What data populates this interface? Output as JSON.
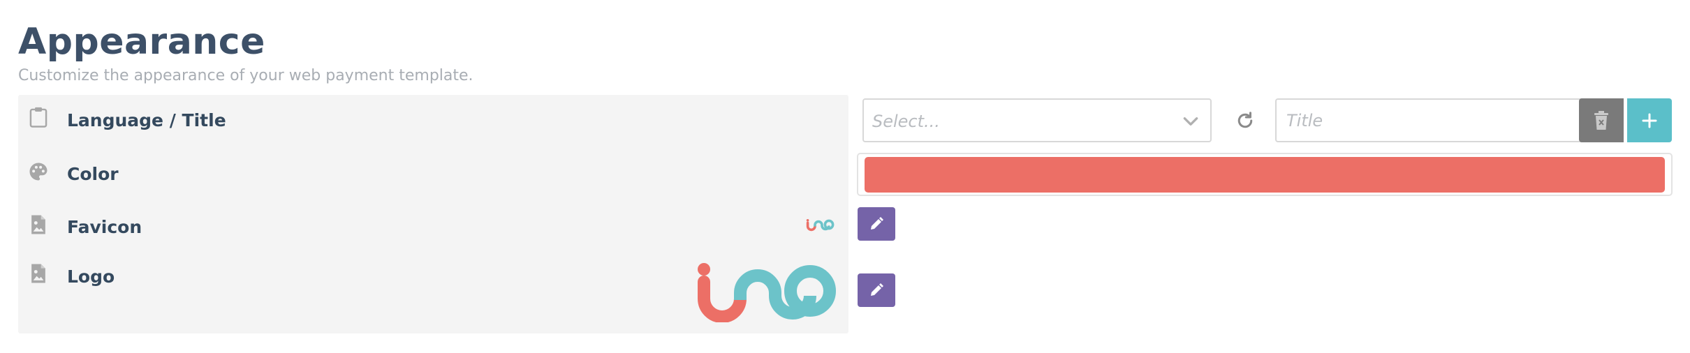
{
  "header": {
    "title": "Appearance",
    "subtitle": "Customize the appearance of your web payment template."
  },
  "rows": [
    {
      "label": "Language / Title",
      "icon": "clipboard-icon"
    },
    {
      "label": "Color",
      "icon": "palette-icon"
    },
    {
      "label": "Favicon",
      "icon": "image-file-icon"
    },
    {
      "label": "Logo",
      "icon": "image-file-icon"
    }
  ],
  "language_select": {
    "placeholder": "Select..."
  },
  "title_input": {
    "placeholder": "Title",
    "value": ""
  },
  "color": {
    "value": "#ec6f66"
  },
  "brand_colors": {
    "coral": "#ec6f66",
    "teal": "#6cc3c9",
    "edit_purple": "#7563a8",
    "add_teal": "#5bbfc9",
    "delete_gray": "#7a7a7a"
  }
}
